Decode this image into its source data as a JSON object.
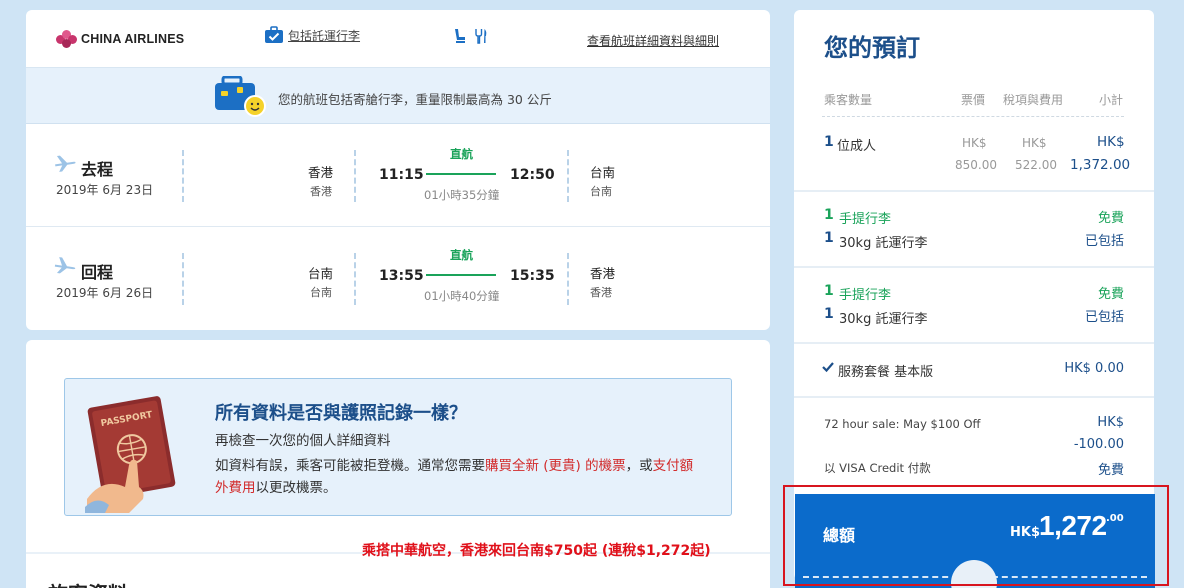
{
  "flight": {
    "airline": "CHINA AIRLINES",
    "baggage_link": "包括託運行李",
    "details_link": "查看航班詳細資料與細則",
    "baggage_notice": "您的航班包括寄艙行李，重量限制最高為 30 公斤",
    "legs": [
      {
        "direction": "去程",
        "date": "2019年 6月 23日",
        "from_city": "香港",
        "from_sub": "香港",
        "dep_time": "11:15",
        "type": "直航",
        "arr_time": "12:50",
        "duration": "01小時35分鐘",
        "to_city": "台南",
        "to_sub": "台南"
      },
      {
        "direction": "回程",
        "date": "2019年 6月 26日",
        "from_city": "台南",
        "from_sub": "台南",
        "dep_time": "13:55",
        "type": "直航",
        "arr_time": "15:35",
        "duration": "01小時40分鐘",
        "to_city": "香港",
        "to_sub": "香港"
      }
    ]
  },
  "notice": {
    "title": "所有資料是否與護照記錄一樣？",
    "subtitle": "再檢查一次您的個人詳細資料",
    "body_1": "如資料有誤，乘客可能被拒登機。通常您需要",
    "body_link_1": "購買全新 (更貴) 的機票",
    "body_2": "，或",
    "body_link_2": "支付額外費用",
    "body_3": "以更改機票。",
    "passport_text": "PASSPORT"
  },
  "passenger_section": {
    "title": "旅客資料"
  },
  "promo": "乘搭中華航空，香港來回台南$750起 (連稅$1,272起)",
  "booking": {
    "title": "您的預訂",
    "headers": {
      "passengers": "乘客數量",
      "fare": "票價",
      "tax": "稅項與費用",
      "subtotal": "小計"
    },
    "pax_qty": "1",
    "pax_label": "位成人",
    "fare_cur": "HK$",
    "fare_val": "850.00",
    "tax_cur": "HK$",
    "tax_val": "522.00",
    "sub_cur": "HK$",
    "sub_val": "1,372.00",
    "baggage_groups": [
      {
        "carry_qty": "1",
        "carry_label": "手提行李",
        "carry_val": "免費",
        "check_qty": "1",
        "check_label": "30kg 託運行李",
        "check_val": "已包括"
      },
      {
        "carry_qty": "1",
        "carry_label": "手提行李",
        "carry_val": "免費",
        "check_qty": "1",
        "check_label": "30kg 託運行李",
        "check_val": "已包括"
      }
    ],
    "service_label": "服務套餐 基本版",
    "service_val": "HK$ 0.00",
    "discount_label": "72 hour sale: May $100 Off",
    "discount_cur": "HK$",
    "discount_val": "-100.00",
    "visa_label": "以 VISA Credit 付款",
    "visa_val": "免費",
    "total_label": "總額",
    "total_cur": "HK$",
    "total_int": "1,272",
    "total_dec": ".00"
  },
  "colors": {
    "navy": "#1c4f8a",
    "green": "#1aa35a",
    "total_blue": "#0b6bcb",
    "highlight_red": "#d8151f"
  }
}
